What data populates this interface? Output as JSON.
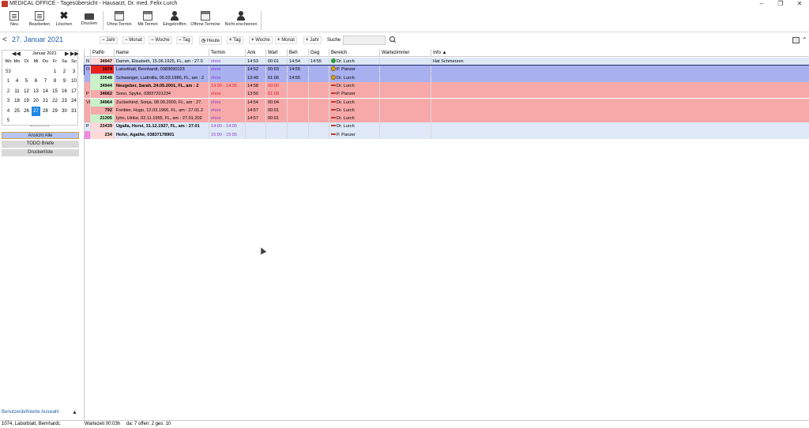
{
  "window": {
    "title": "MEDICAL OFFICE - Tagesübersicht - Hausarzt, Dr. med. Felix Lurch",
    "controls": {
      "minimize": "–",
      "maximize": "❐",
      "close": "✕"
    }
  },
  "toolbar": {
    "buttons": [
      {
        "label": "Neu",
        "icon": "new-document-icon"
      },
      {
        "label": "Bearbeiten",
        "icon": "edit-icon"
      },
      {
        "label": "Löschen",
        "icon": "delete-icon"
      },
      {
        "label": "Drucken",
        "icon": "printer-icon"
      },
      {
        "label": "Ohne Termin",
        "icon": "calendar-icon"
      },
      {
        "label": "Mit Termin",
        "icon": "calendar-icon"
      },
      {
        "label": "Eingetroffen",
        "icon": "person-icon"
      },
      {
        "label": "Offene Termine",
        "icon": "calendar-icon"
      },
      {
        "label": "Nicht erschienen",
        "icon": "person-icon"
      }
    ]
  },
  "nav": {
    "date": "27. Januar 2021",
    "back_arrow": "<",
    "buttons": [
      "Jahr",
      "Monat",
      "Woche",
      "Tag",
      "Heute",
      "Tag",
      "Woche",
      "Monat",
      "Jahr"
    ],
    "button_prefixes": [
      "−",
      "−",
      "−",
      "−",
      "◷",
      "+",
      "+",
      "+",
      "+"
    ],
    "search_label": "Suche",
    "search_value": ""
  },
  "calendar": {
    "month_label": "Januar 2021",
    "nav": {
      "first": "◀◀",
      "prev": "◀",
      "next": "▶",
      "last": "▶▶"
    },
    "weekday_header": [
      "Wo",
      "Mo",
      "Di",
      "Mi",
      "Do",
      "Fr",
      "Sa",
      "So"
    ],
    "weeks": [
      {
        "week": "53",
        "days": [
          "",
          "",
          "",
          "",
          "1",
          "2",
          "3"
        ]
      },
      {
        "week": "1",
        "days": [
          "4",
          "5",
          "6",
          "7",
          "8",
          "9",
          "10"
        ]
      },
      {
        "week": "2",
        "days": [
          "11",
          "12",
          "13",
          "14",
          "15",
          "16",
          "17"
        ]
      },
      {
        "week": "3",
        "days": [
          "18",
          "19",
          "20",
          "21",
          "22",
          "23",
          "24"
        ]
      },
      {
        "week": "4",
        "days": [
          "25",
          "26",
          "27",
          "28",
          "29",
          "30",
          "31"
        ]
      },
      {
        "week": "5",
        "days": [
          "",
          "",
          "",
          "",
          "",
          "",
          ""
        ]
      }
    ],
    "selected_day": "27"
  },
  "left_list": {
    "items": [
      "Ansicht Alle",
      "TODO Briefe",
      "Druckerliste"
    ],
    "footer": "Benutzerdefinierte Auswahl",
    "footer_chevron": "▲"
  },
  "grid": {
    "columns": [
      "",
      "PatNr",
      "Name",
      "Termin",
      "Ank",
      "Wart",
      "Beh",
      "Geg",
      "Bereich",
      "Wartezimmer",
      "Info ▲"
    ],
    "rows": [
      {
        "flag": "N",
        "patnr": "34947",
        "name": "Damm, Elisabeth, 15.06.1925, FL, am : 27.0",
        "termin": "ohne",
        "ank": "14:53",
        "wart": "00:01",
        "beh": "14:54",
        "geg": "14:55",
        "bereich": "Dr. Lurch",
        "mark": "check",
        "wartezimmer": "",
        "info": "Hat Schmerzen",
        "bg": "#dfe8f7",
        "patbg": "#ffd9d9",
        "tcolor": "purple",
        "bold": false
      },
      {
        "flag": "O",
        "patnr": "1074",
        "name": "Laborblatt, Bernhardt, 0383690123",
        "termin": "ohne",
        "ank": "14:52",
        "wart": "00:03",
        "beh": "14:55",
        "geg": "",
        "bereich": "P. Panzer",
        "mark": "warn",
        "wartezimmer": "",
        "info": "",
        "bg": "#a9b0f0",
        "patbg": "#e8201a",
        "tcolor": "purple",
        "bold": false
      },
      {
        "flag": "",
        "patnr": "33548",
        "name": "Schwanger, Ludmilla, 05.03.1986, FL, am : 2",
        "termin": "ohne",
        "ank": "13:49",
        "wart": "01:06",
        "beh": "14:55",
        "geg": "",
        "bereich": "Dr. Lurch",
        "mark": "warn",
        "wartezimmer": "",
        "info": "",
        "bg": "#a9b0f0",
        "patbg": "#c9f2c9",
        "tcolor": "purple",
        "bold": false
      },
      {
        "flag": "",
        "patnr": "34944",
        "name": "Neugeber, Sarah, 24.05.2001, FL, am : 2",
        "termin": "14:30 - 14:35",
        "ank": "14:58",
        "wart": "00:00",
        "beh": "",
        "geg": "",
        "bereich": "Dr. Lurch",
        "mark": "dash",
        "wartezimmer": "",
        "info": "",
        "bg": "#f7a9a9",
        "patbg": "#c9f2c9",
        "tcolor": "red",
        "bold": true
      },
      {
        "flag": "P",
        "patnr": "34662",
        "name": "Sono, Spyke, 03837201234",
        "termin": "ohne",
        "ank": "13:50",
        "wart": "01:08",
        "beh": "",
        "geg": "",
        "bereich": "P. Panzer",
        "mark": "dash",
        "wartezimmer": "",
        "info": "",
        "bg": "#f7a9a9",
        "patbg": "#f7a9a9",
        "tcolor": "red",
        "bold": false
      },
      {
        "flag": "VI",
        "patnr": "34964",
        "name": "Zuckerkind, Sonja, 08.09.2000, FL, am : 27.",
        "termin": "ohne",
        "ank": "14:54",
        "wart": "00:04",
        "beh": "",
        "geg": "",
        "bereich": "Dr. Lurch",
        "mark": "dash",
        "wartezimmer": "",
        "info": "",
        "bg": "#f7a9a9",
        "patbg": "#c9f2c9",
        "tcolor": "purple",
        "bold": false
      },
      {
        "flag": "",
        "patnr": "792",
        "name": "Freibier, Hugo, 12.03.1966, FL, am : 27.01.2",
        "termin": "ohne",
        "ank": "14:57",
        "wart": "00:01",
        "beh": "",
        "geg": "",
        "bereich": "Dr. Lurch",
        "mark": "dash",
        "wartezimmer": "",
        "info": "",
        "bg": "#f7a9a9",
        "patbg": "#f7a9a9",
        "tcolor": "purple",
        "bold": false
      },
      {
        "flag": "",
        "patnr": "21305",
        "name": "Iyhn, Ulrike, 02.11.1955, FL, am : 27.01.202",
        "termin": "ohne",
        "ank": "14:57",
        "wart": "00:01",
        "beh": "",
        "geg": "",
        "bereich": "Dr. Lurch",
        "mark": "dash",
        "wartezimmer": "",
        "info": "",
        "bg": "#f7a9a9",
        "patbg": "#c9f2c9",
        "tcolor": "purple",
        "bold": false
      },
      {
        "flag": "P",
        "patnr": "23439",
        "name": "Ugalla, Horst, 31.12.1927, FL, am : 27.01",
        "termin": "14:00 - 14:05",
        "ank": "",
        "wart": "",
        "beh": "",
        "geg": "",
        "bereich": "Dr. Lurch",
        "mark": "dash",
        "wartezimmer": "",
        "info": "",
        "bg": "#dfe8f7",
        "patbg": "#ffd9d9",
        "tcolor": "purple",
        "bold": true
      },
      {
        "flag": "",
        "patnr": "234",
        "name": "Hohn, Agathe, 03837178901",
        "termin": "15:00 - 15:05",
        "ank": "",
        "wart": "",
        "beh": "",
        "geg": "",
        "bereich": "P. Panzer",
        "mark": "dash",
        "wartezimmer": "",
        "info": "",
        "bg": "#dfe8f7",
        "patbg": "#ffd9d9",
        "tcolor": "purple",
        "bold": true,
        "flagbg": "#ee88dd"
      }
    ]
  },
  "status": {
    "patient": "1074, Laborblatt, Bernhardt,",
    "wait": "Wartezeit 00:03h",
    "summary": "da: 7 offen: 2 ges: 10"
  }
}
